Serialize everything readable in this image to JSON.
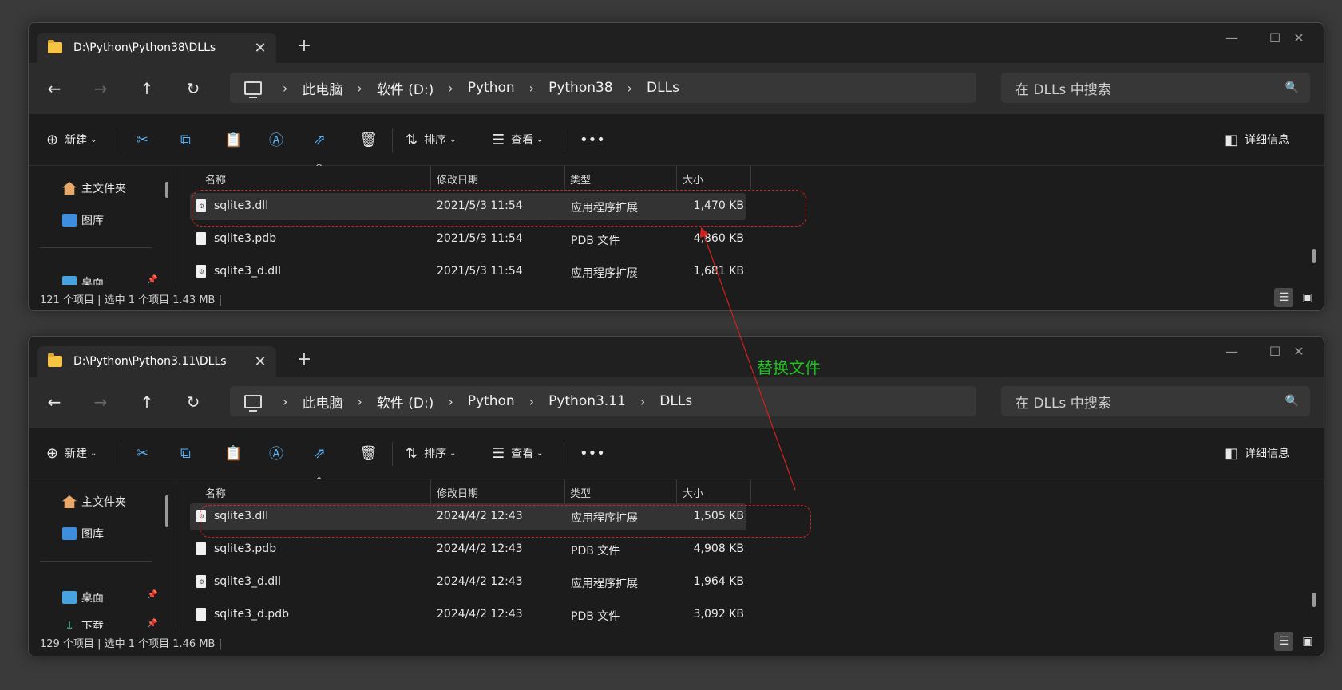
{
  "windows": [
    {
      "tab_title": "D:\\Python\\Python38\\DLLs",
      "breadcrumbs": [
        "此电脑",
        "软件 (D:)",
        "Python",
        "Python38",
        "DLLs"
      ],
      "search_placeholder": "在 DLLs 中搜索",
      "toolbar": {
        "new_label": "新建",
        "sort_label": "排序",
        "view_label": "查看",
        "details_label": "详细信息"
      },
      "sidebar": {
        "home": "主文件夹",
        "gallery": "图库",
        "desktop": "桌面"
      },
      "columns": [
        "名称",
        "修改日期",
        "类型",
        "大小"
      ],
      "files": [
        {
          "name": "sqlite3.dll",
          "date": "2021/5/3 11:54",
          "type": "应用程序扩展",
          "size": "1,470 KB"
        },
        {
          "name": "sqlite3.pdb",
          "date": "2021/5/3 11:54",
          "type": "PDB 文件",
          "size": "4,860 KB"
        },
        {
          "name": "sqlite3_d.dll",
          "date": "2021/5/3 11:54",
          "type": "应用程序扩展",
          "size": "1,681 KB"
        }
      ],
      "status": "121 个项目  |  选中 1 个项目  1.43 MB  |"
    },
    {
      "tab_title": "D:\\Python\\Python3.11\\DLLs",
      "breadcrumbs": [
        "此电脑",
        "软件 (D:)",
        "Python",
        "Python3.11",
        "DLLs"
      ],
      "search_placeholder": "在 DLLs 中搜索",
      "toolbar": {
        "new_label": "新建",
        "sort_label": "排序",
        "view_label": "查看",
        "details_label": "详细信息"
      },
      "sidebar": {
        "home": "主文件夹",
        "gallery": "图库",
        "desktop": "桌面",
        "downloads": "下载"
      },
      "columns": [
        "名称",
        "修改日期",
        "类型",
        "大小"
      ],
      "files": [
        {
          "name": "sqlite3.dll",
          "date": "2024/4/2 12:43",
          "type": "应用程序扩展",
          "size": "1,505 KB"
        },
        {
          "name": "sqlite3.pdb",
          "date": "2024/4/2 12:43",
          "type": "PDB 文件",
          "size": "4,908 KB"
        },
        {
          "name": "sqlite3_d.dll",
          "date": "2024/4/2 12:43",
          "type": "应用程序扩展",
          "size": "1,964 KB"
        },
        {
          "name": "sqlite3_d.pdb",
          "date": "2024/4/2 12:43",
          "type": "PDB 文件",
          "size": "3,092 KB"
        }
      ],
      "status": "129 个项目  |  选中 1 个项目  1.46 MB  |"
    }
  ],
  "annotation": {
    "text": "替换文件",
    "color": "#21c121",
    "arrow_color": "#d42020"
  },
  "colors": {
    "background": "#3a3a3a",
    "window": "#1c1c1c",
    "selection": "#333333",
    "accent": "#5ab0f0"
  }
}
